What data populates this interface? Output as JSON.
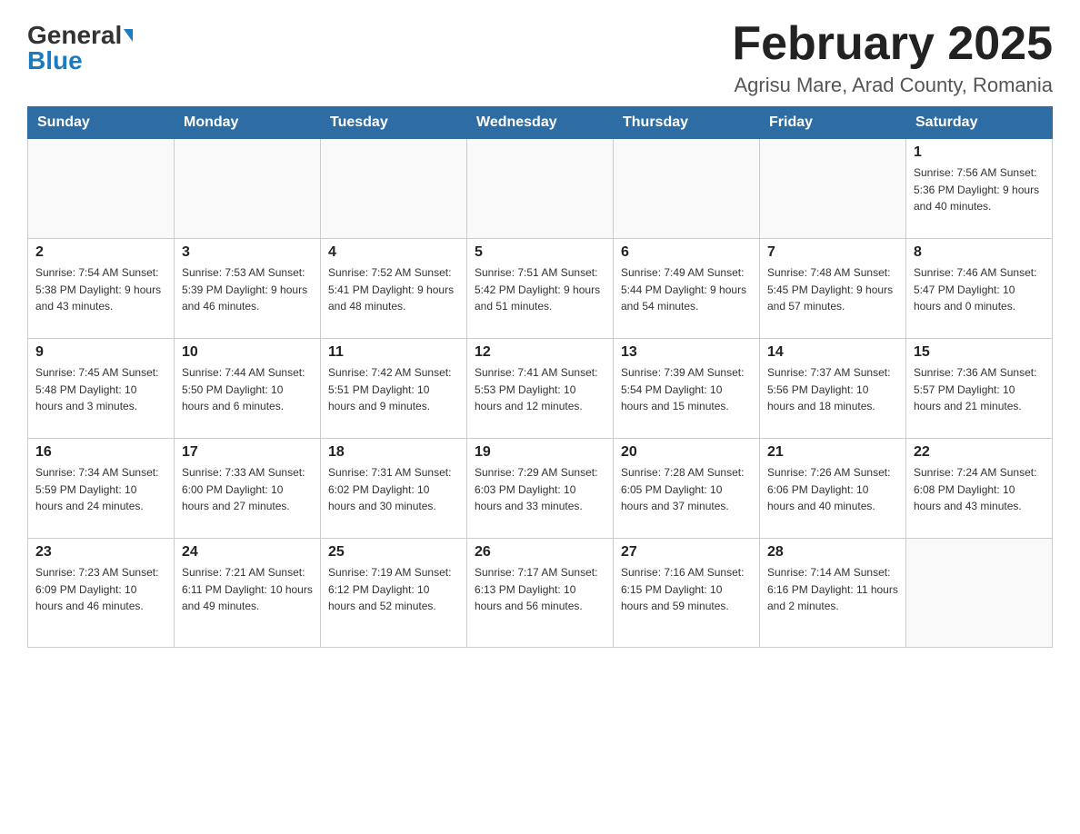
{
  "header": {
    "logo_general": "General",
    "logo_blue": "Blue",
    "title": "February 2025",
    "subtitle": "Agrisu Mare, Arad County, Romania"
  },
  "weekdays": [
    "Sunday",
    "Monday",
    "Tuesday",
    "Wednesday",
    "Thursday",
    "Friday",
    "Saturday"
  ],
  "weeks": [
    [
      {
        "day": "",
        "info": ""
      },
      {
        "day": "",
        "info": ""
      },
      {
        "day": "",
        "info": ""
      },
      {
        "day": "",
        "info": ""
      },
      {
        "day": "",
        "info": ""
      },
      {
        "day": "",
        "info": ""
      },
      {
        "day": "1",
        "info": "Sunrise: 7:56 AM\nSunset: 5:36 PM\nDaylight: 9 hours\nand 40 minutes."
      }
    ],
    [
      {
        "day": "2",
        "info": "Sunrise: 7:54 AM\nSunset: 5:38 PM\nDaylight: 9 hours\nand 43 minutes."
      },
      {
        "day": "3",
        "info": "Sunrise: 7:53 AM\nSunset: 5:39 PM\nDaylight: 9 hours\nand 46 minutes."
      },
      {
        "day": "4",
        "info": "Sunrise: 7:52 AM\nSunset: 5:41 PM\nDaylight: 9 hours\nand 48 minutes."
      },
      {
        "day": "5",
        "info": "Sunrise: 7:51 AM\nSunset: 5:42 PM\nDaylight: 9 hours\nand 51 minutes."
      },
      {
        "day": "6",
        "info": "Sunrise: 7:49 AM\nSunset: 5:44 PM\nDaylight: 9 hours\nand 54 minutes."
      },
      {
        "day": "7",
        "info": "Sunrise: 7:48 AM\nSunset: 5:45 PM\nDaylight: 9 hours\nand 57 minutes."
      },
      {
        "day": "8",
        "info": "Sunrise: 7:46 AM\nSunset: 5:47 PM\nDaylight: 10 hours\nand 0 minutes."
      }
    ],
    [
      {
        "day": "9",
        "info": "Sunrise: 7:45 AM\nSunset: 5:48 PM\nDaylight: 10 hours\nand 3 minutes."
      },
      {
        "day": "10",
        "info": "Sunrise: 7:44 AM\nSunset: 5:50 PM\nDaylight: 10 hours\nand 6 minutes."
      },
      {
        "day": "11",
        "info": "Sunrise: 7:42 AM\nSunset: 5:51 PM\nDaylight: 10 hours\nand 9 minutes."
      },
      {
        "day": "12",
        "info": "Sunrise: 7:41 AM\nSunset: 5:53 PM\nDaylight: 10 hours\nand 12 minutes."
      },
      {
        "day": "13",
        "info": "Sunrise: 7:39 AM\nSunset: 5:54 PM\nDaylight: 10 hours\nand 15 minutes."
      },
      {
        "day": "14",
        "info": "Sunrise: 7:37 AM\nSunset: 5:56 PM\nDaylight: 10 hours\nand 18 minutes."
      },
      {
        "day": "15",
        "info": "Sunrise: 7:36 AM\nSunset: 5:57 PM\nDaylight: 10 hours\nand 21 minutes."
      }
    ],
    [
      {
        "day": "16",
        "info": "Sunrise: 7:34 AM\nSunset: 5:59 PM\nDaylight: 10 hours\nand 24 minutes."
      },
      {
        "day": "17",
        "info": "Sunrise: 7:33 AM\nSunset: 6:00 PM\nDaylight: 10 hours\nand 27 minutes."
      },
      {
        "day": "18",
        "info": "Sunrise: 7:31 AM\nSunset: 6:02 PM\nDaylight: 10 hours\nand 30 minutes."
      },
      {
        "day": "19",
        "info": "Sunrise: 7:29 AM\nSunset: 6:03 PM\nDaylight: 10 hours\nand 33 minutes."
      },
      {
        "day": "20",
        "info": "Sunrise: 7:28 AM\nSunset: 6:05 PM\nDaylight: 10 hours\nand 37 minutes."
      },
      {
        "day": "21",
        "info": "Sunrise: 7:26 AM\nSunset: 6:06 PM\nDaylight: 10 hours\nand 40 minutes."
      },
      {
        "day": "22",
        "info": "Sunrise: 7:24 AM\nSunset: 6:08 PM\nDaylight: 10 hours\nand 43 minutes."
      }
    ],
    [
      {
        "day": "23",
        "info": "Sunrise: 7:23 AM\nSunset: 6:09 PM\nDaylight: 10 hours\nand 46 minutes."
      },
      {
        "day": "24",
        "info": "Sunrise: 7:21 AM\nSunset: 6:11 PM\nDaylight: 10 hours\nand 49 minutes."
      },
      {
        "day": "25",
        "info": "Sunrise: 7:19 AM\nSunset: 6:12 PM\nDaylight: 10 hours\nand 52 minutes."
      },
      {
        "day": "26",
        "info": "Sunrise: 7:17 AM\nSunset: 6:13 PM\nDaylight: 10 hours\nand 56 minutes."
      },
      {
        "day": "27",
        "info": "Sunrise: 7:16 AM\nSunset: 6:15 PM\nDaylight: 10 hours\nand 59 minutes."
      },
      {
        "day": "28",
        "info": "Sunrise: 7:14 AM\nSunset: 6:16 PM\nDaylight: 11 hours\nand 2 minutes."
      },
      {
        "day": "",
        "info": ""
      }
    ]
  ]
}
